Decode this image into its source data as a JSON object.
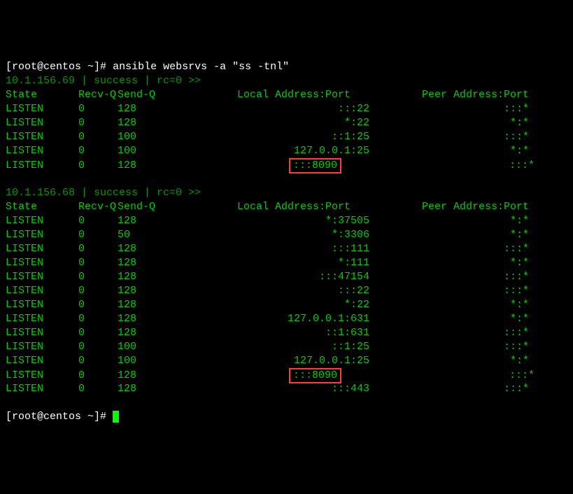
{
  "prompt": {
    "userhost": "[root@centos ",
    "path": "~",
    "close": "]# ",
    "command": "ansible websrvs -a \"ss -tnl\""
  },
  "headers": {
    "state": "State",
    "recvq": "Recv-Q",
    "sendq": "Send-Q",
    "local": "Local Address:Port",
    "peer": "Peer Address:Port"
  },
  "host1": {
    "status": "10.1.156.69 | success | rc=0 >>",
    "rows": [
      {
        "state": "LISTEN",
        "recvq": "0",
        "sendq": "128",
        "local": ":::22",
        "peer": ":::*",
        "hl": false
      },
      {
        "state": "LISTEN",
        "recvq": "0",
        "sendq": "128",
        "local": "*:22",
        "peer": "*:*",
        "hl": false
      },
      {
        "state": "LISTEN",
        "recvq": "0",
        "sendq": "100",
        "local": "::1:25",
        "peer": ":::*",
        "hl": false
      },
      {
        "state": "LISTEN",
        "recvq": "0",
        "sendq": "100",
        "local": "127.0.0.1:25",
        "peer": "*:*",
        "hl": false
      },
      {
        "state": "LISTEN",
        "recvq": "0",
        "sendq": "128",
        "local": ":::8090",
        "peer": ":::*",
        "hl": true
      }
    ]
  },
  "host2": {
    "status": "10.1.156.68 | success | rc=0 >>",
    "rows": [
      {
        "state": "LISTEN",
        "recvq": "0",
        "sendq": "128",
        "local": "*:37505",
        "peer": "*:*",
        "hl": false
      },
      {
        "state": "LISTEN",
        "recvq": "0",
        "sendq": "50",
        "local": "*:3306",
        "peer": "*:*",
        "hl": false
      },
      {
        "state": "LISTEN",
        "recvq": "0",
        "sendq": "128",
        "local": ":::111",
        "peer": ":::*",
        "hl": false
      },
      {
        "state": "LISTEN",
        "recvq": "0",
        "sendq": "128",
        "local": "*:111",
        "peer": "*:*",
        "hl": false
      },
      {
        "state": "LISTEN",
        "recvq": "0",
        "sendq": "128",
        "local": ":::47154",
        "peer": ":::*",
        "hl": false
      },
      {
        "state": "LISTEN",
        "recvq": "0",
        "sendq": "128",
        "local": ":::22",
        "peer": ":::*",
        "hl": false
      },
      {
        "state": "LISTEN",
        "recvq": "0",
        "sendq": "128",
        "local": "*:22",
        "peer": "*:*",
        "hl": false
      },
      {
        "state": "LISTEN",
        "recvq": "0",
        "sendq": "128",
        "local": "127.0.0.1:631",
        "peer": "*:*",
        "hl": false
      },
      {
        "state": "LISTEN",
        "recvq": "0",
        "sendq": "128",
        "local": "::1:631",
        "peer": ":::*",
        "hl": false
      },
      {
        "state": "LISTEN",
        "recvq": "0",
        "sendq": "100",
        "local": "::1:25",
        "peer": ":::*",
        "hl": false
      },
      {
        "state": "LISTEN",
        "recvq": "0",
        "sendq": "100",
        "local": "127.0.0.1:25",
        "peer": "*:*",
        "hl": false
      },
      {
        "state": "LISTEN",
        "recvq": "0",
        "sendq": "128",
        "local": ":::8090",
        "peer": ":::*",
        "hl": true
      },
      {
        "state": "LISTEN",
        "recvq": "0",
        "sendq": "128",
        "local": ":::443",
        "peer": ":::*",
        "hl": false
      }
    ]
  }
}
